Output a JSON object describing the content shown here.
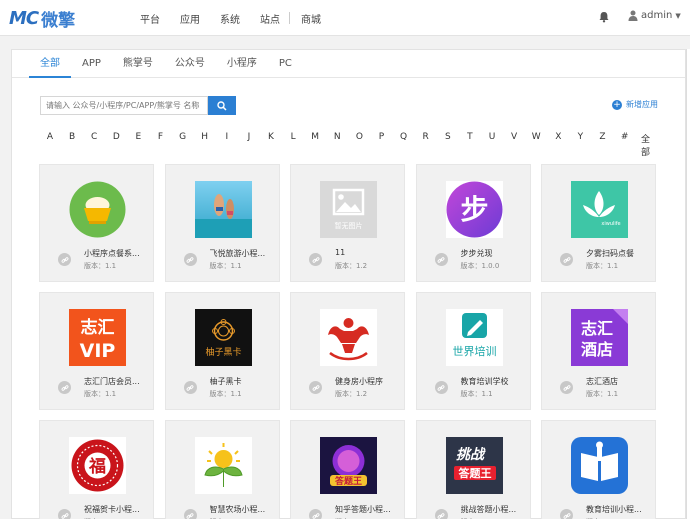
{
  "header": {
    "logo_mark": "MC",
    "logo_text": "微擎",
    "nav": [
      "平台",
      "应用",
      "系统",
      "站点",
      "商城"
    ],
    "user": "admin"
  },
  "tabs": [
    "全部",
    "APP",
    "熊掌号",
    "公众号",
    "小程序",
    "PC"
  ],
  "search": {
    "placeholder": "请输入 公众号/小程序/PC/APP/熊掌号 名称"
  },
  "add_app": "新增应用",
  "letters": [
    "A",
    "B",
    "C",
    "D",
    "E",
    "F",
    "G",
    "H",
    "I",
    "J",
    "K",
    "L",
    "M",
    "N",
    "O",
    "P",
    "Q",
    "R",
    "S",
    "T",
    "U",
    "V",
    "W",
    "X",
    "Y",
    "Z",
    "#",
    "全部"
  ],
  "cards": [
    {
      "name": "小程序点餐系...",
      "version": "版本：1.1",
      "icon": "rice-bowl-icon"
    },
    {
      "name": "飞悦旅游小程...",
      "version": "版本：1.1",
      "icon": "beach-photo-icon"
    },
    {
      "name": "11",
      "version": "版本：1.2",
      "icon": "no-image-placeholder-icon",
      "placeholder_text": "暂无图片"
    },
    {
      "name": "步步兑现",
      "version": "版本：1.0.0",
      "icon": "step-logo-icon",
      "logo_text": "步"
    },
    {
      "name": "夕雾扫码点餐",
      "version": "版本：1.1",
      "icon": "xiwu-leaf-icon",
      "logo_text": "xiwulife"
    },
    {
      "name": "志汇门店会员...",
      "version": "版本：1.1",
      "icon": "zhihui-vip-icon",
      "logo_text": "志汇\nVIP"
    },
    {
      "name": "柚子黑卡",
      "version": "版本：1.1",
      "icon": "black-card-icon",
      "logo_text": "柚子黑卡"
    },
    {
      "name": "健身房小程序",
      "version": "版本：1.2",
      "icon": "muscle-man-icon"
    },
    {
      "name": "教育培训学校",
      "version": "版本：1.1",
      "icon": "world-training-icon",
      "logo_text": "世界培训"
    },
    {
      "name": "志汇酒店",
      "version": "版本：1.1",
      "icon": "zhihui-hotel-icon",
      "logo_text": "志汇\n酒店"
    },
    {
      "name": "祝福贺卡小程...",
      "version": "版本：1.1",
      "icon": "paper-cut-fu-icon",
      "logo_text": "福"
    },
    {
      "name": "智慧农场小程...",
      "version": "版本：1.1",
      "icon": "sprout-sun-icon"
    },
    {
      "name": "知乎答题小程...",
      "version": "版本：1.1",
      "icon": "quiz-king-icon",
      "logo_text": "答题王"
    },
    {
      "name": "挑战答题小程...",
      "version": "版本：1.1",
      "icon": "challenge-quiz-icon",
      "logo_text": "挑战\n答题王"
    },
    {
      "name": "教育培训小程...",
      "version": "版本：1.1",
      "icon": "open-book-icon"
    }
  ]
}
